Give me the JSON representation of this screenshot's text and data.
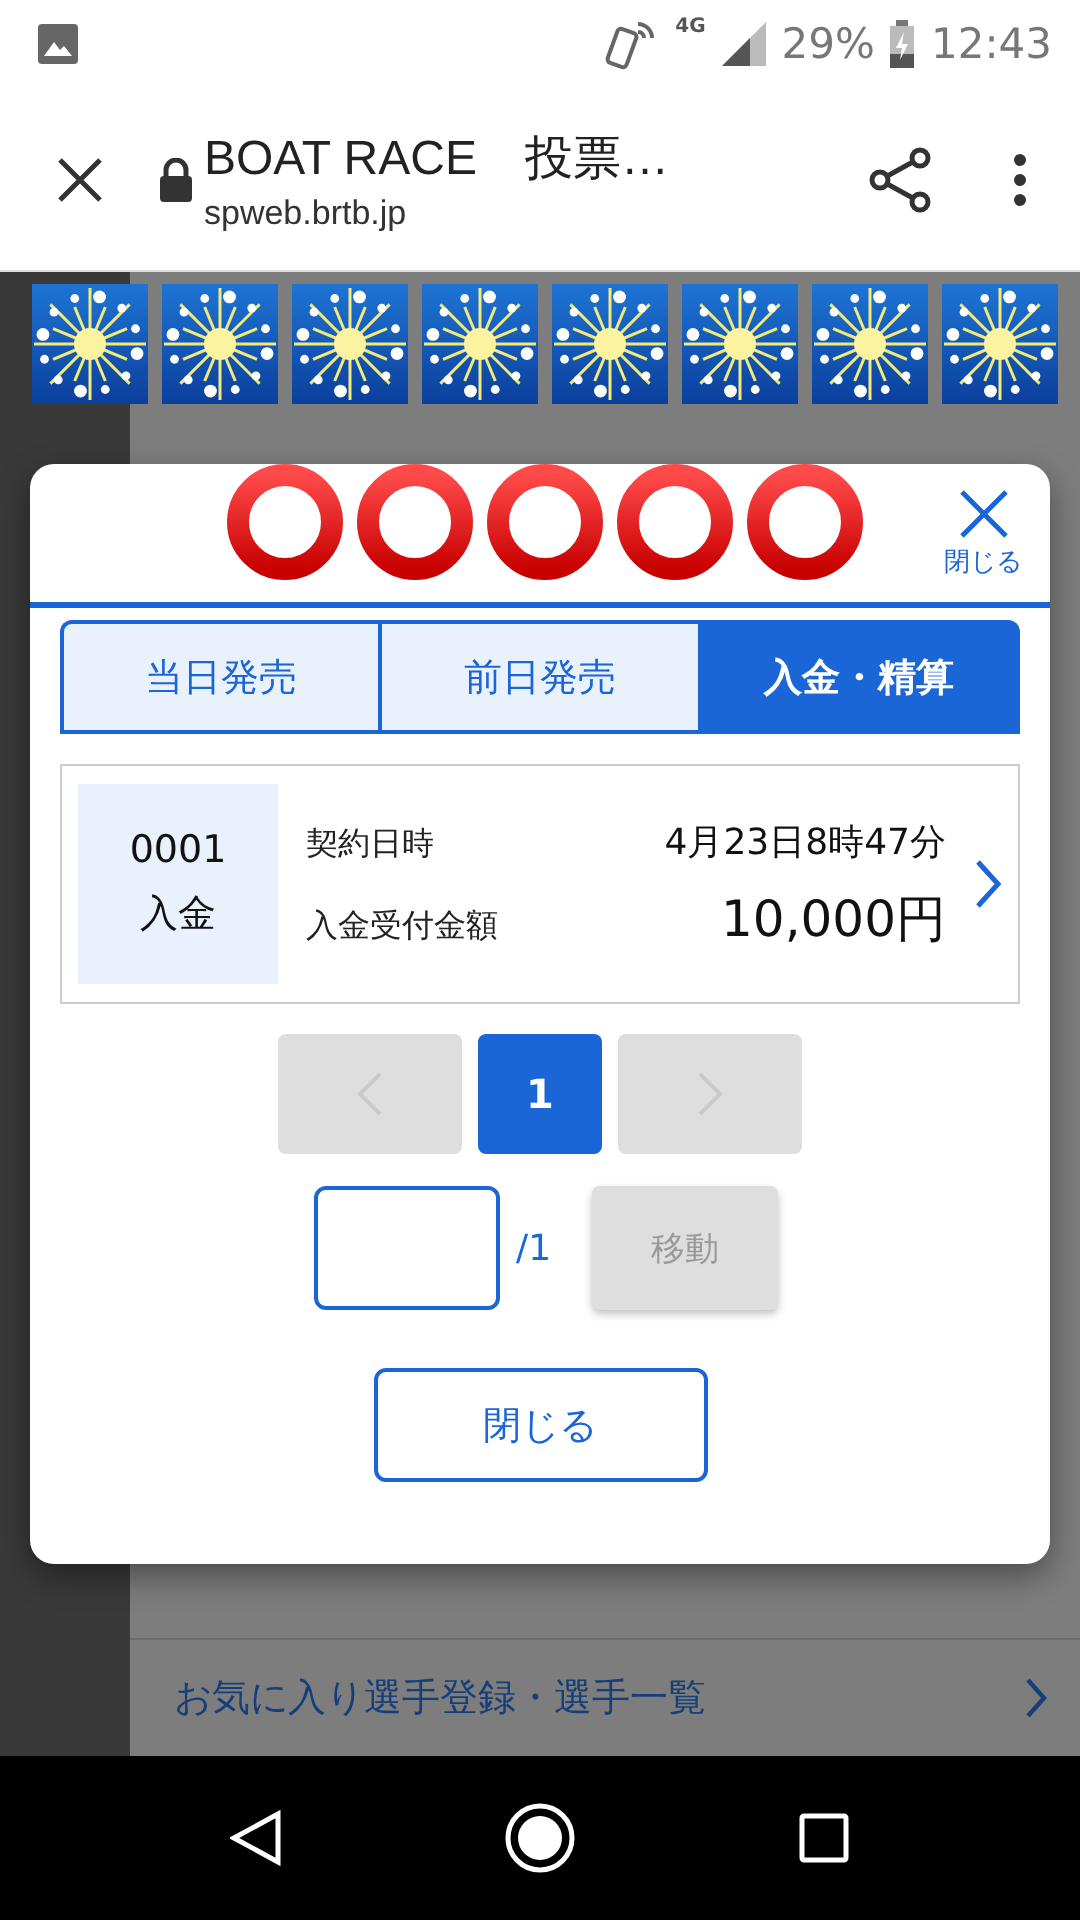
{
  "status_bar": {
    "network": "4G",
    "battery": "29%",
    "time": "12:43"
  },
  "browser": {
    "title": "BOAT RACE　投票…",
    "url": "spweb.brtb.jp"
  },
  "background": {
    "menu_items": [
      {
        "label": "お気に入り選手登録・選手一覧"
      }
    ]
  },
  "dialog": {
    "close_label": "閉じる",
    "tabs": [
      {
        "label": "当日発売",
        "selected": false
      },
      {
        "label": "前日発売",
        "selected": false
      },
      {
        "label": "入金・精算",
        "selected": true
      }
    ],
    "contracts": [
      {
        "number": "0001",
        "type": "入金",
        "rows": [
          {
            "label": "契約日時",
            "value": "4月23日8時47分"
          },
          {
            "label": "入金受付金額",
            "value": "10,000円"
          }
        ]
      }
    ],
    "pagination": {
      "prev_disabled": true,
      "next_disabled": true,
      "pages": [
        {
          "label": "1",
          "selected": true
        }
      ]
    },
    "jump": {
      "total": "/1",
      "button": "移動",
      "disabled": true
    },
    "close_button": "閉じる"
  },
  "stickers": [
    {
      "kind": "sparkle"
    },
    {
      "kind": "sparkle"
    },
    {
      "kind": "sparkle"
    },
    {
      "kind": "sparkle"
    },
    {
      "kind": "sparkle"
    },
    {
      "kind": "sparkle"
    },
    {
      "kind": "sparkle"
    },
    {
      "kind": "sparkle"
    }
  ],
  "marks": [
    {
      "kind": "ring"
    },
    {
      "kind": "ring"
    },
    {
      "kind": "ring"
    },
    {
      "kind": "ring"
    },
    {
      "kind": "ring"
    }
  ]
}
